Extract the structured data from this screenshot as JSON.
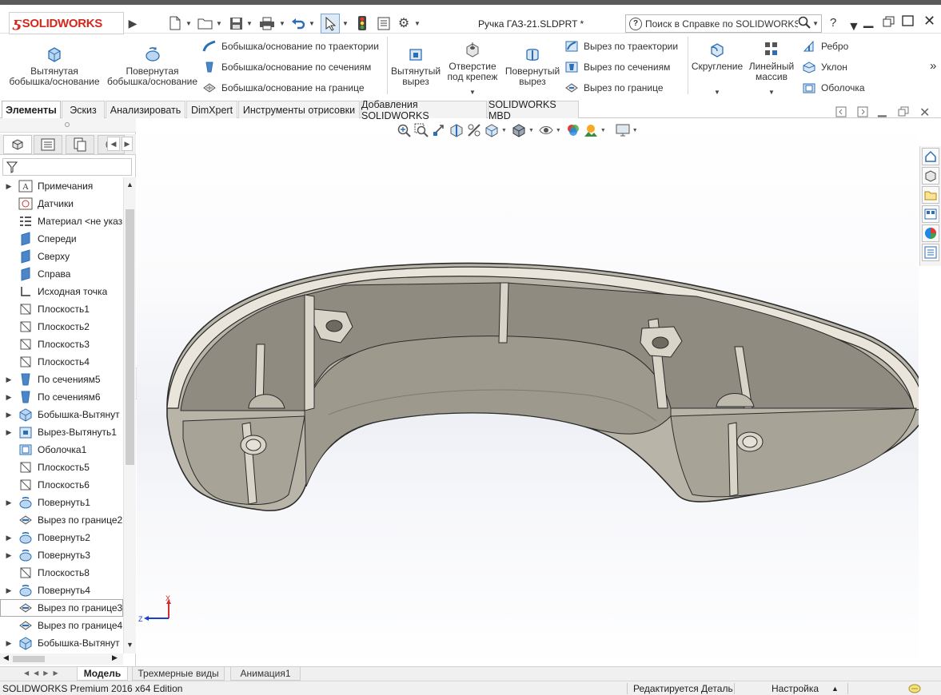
{
  "app": {
    "logo_text": "SOLIDWORKS",
    "document_title": "Ручка ГАЗ-21.SLDPRT *",
    "search_placeholder": "Поиск в Справке по SOLIDWORKS",
    "help_label": "?"
  },
  "command_manager": {
    "extruded_boss": "Вытянутая бобышка/основание",
    "revolved_boss": "Повернутая бобышка/основание",
    "swept_boss": "Бобышка/основание по траектории",
    "lofted_boss": "Бобышка/основание по сечениям",
    "boundary_boss": "Бобышка/основание на границе",
    "extruded_cut": "Вытянутый вырез",
    "hole_wizard": "Отверстие под крепеж",
    "revolved_cut": "Повернутый вырез",
    "swept_cut": "Вырез по траектории",
    "lofted_cut": "Вырез по сечениям",
    "boundary_cut": "Вырез по границе",
    "fillet": "Скругление",
    "linear_pattern": "Линейный массив",
    "rib": "Ребро",
    "draft": "Уклон",
    "shell": "Оболочка",
    "more": "»"
  },
  "tabs": [
    "Элементы",
    "Эскиз",
    "Анализировать",
    "DimXpert",
    "Инструменты отрисовки",
    "Добавления SOLIDWORKS",
    "SOLIDWORKS MBD"
  ],
  "tree": {
    "items": [
      {
        "label": "Примечания",
        "icon": "annotations-icon",
        "expandable": true
      },
      {
        "label": "Датчики",
        "icon": "sensors-icon",
        "expandable": false
      },
      {
        "label": "Материал <не указ",
        "icon": "material-icon",
        "expandable": false
      },
      {
        "label": "Спереди",
        "icon": "plane-icon",
        "expandable": false
      },
      {
        "label": "Сверху",
        "icon": "plane-icon",
        "expandable": false
      },
      {
        "label": "Справа",
        "icon": "plane-icon",
        "expandable": false
      },
      {
        "label": "Исходная точка",
        "icon": "origin-icon",
        "expandable": false
      },
      {
        "label": "Плоскость1",
        "icon": "ref-plane-icon",
        "expandable": false
      },
      {
        "label": "Плоскость2",
        "icon": "ref-plane-icon",
        "expandable": false
      },
      {
        "label": "Плоскость3",
        "icon": "ref-plane-icon",
        "expandable": false
      },
      {
        "label": "Плоскость4",
        "icon": "ref-plane-icon",
        "expandable": false
      },
      {
        "label": "По сечениям5",
        "icon": "loft-icon",
        "expandable": true
      },
      {
        "label": "По сечениям6",
        "icon": "loft-icon",
        "expandable": true
      },
      {
        "label": "Бобышка-Вытянут",
        "icon": "extrude-icon",
        "expandable": true
      },
      {
        "label": "Вырез-Вытянуть1",
        "icon": "cut-extrude-icon",
        "expandable": true
      },
      {
        "label": "Оболочка1",
        "icon": "shell-icon",
        "expandable": false
      },
      {
        "label": "Плоскость5",
        "icon": "ref-plane-icon",
        "expandable": false
      },
      {
        "label": "Плоскость6",
        "icon": "ref-plane-icon",
        "expandable": false
      },
      {
        "label": "Повернуть1",
        "icon": "revolve-icon",
        "expandable": true
      },
      {
        "label": "Вырез по границе2",
        "icon": "boundary-cut-icon",
        "expandable": false
      },
      {
        "label": "Повернуть2",
        "icon": "revolve-icon",
        "expandable": true
      },
      {
        "label": "Повернуть3",
        "icon": "revolve-icon",
        "expandable": true
      },
      {
        "label": "Плоскость8",
        "icon": "ref-plane-icon",
        "expandable": false
      },
      {
        "label": "Повернуть4",
        "icon": "revolve-icon",
        "expandable": true
      },
      {
        "label": "Вырез по границе3",
        "icon": "boundary-cut-icon",
        "expandable": false,
        "selected": true
      },
      {
        "label": "Вырез по границе4",
        "icon": "boundary-cut-icon",
        "expandable": false
      },
      {
        "label": "Бобышка-Вытянут",
        "icon": "extrude-icon",
        "expandable": true
      }
    ]
  },
  "triad": {
    "x_label": "X",
    "z_label": "Z"
  },
  "bottom_tabs": [
    "Модель",
    "Трехмерные виды",
    "Анимация1"
  ],
  "status": {
    "edition": "SOLIDWORKS Premium 2016 x64 Edition",
    "mode": "Редактируется Деталь",
    "settings": "Настройка"
  },
  "colors": {
    "brand_red": "#d5281b",
    "part_gray": "#9a968c",
    "part_edge": "#2b2b2b",
    "icon_blue": "#2c6fb7"
  }
}
